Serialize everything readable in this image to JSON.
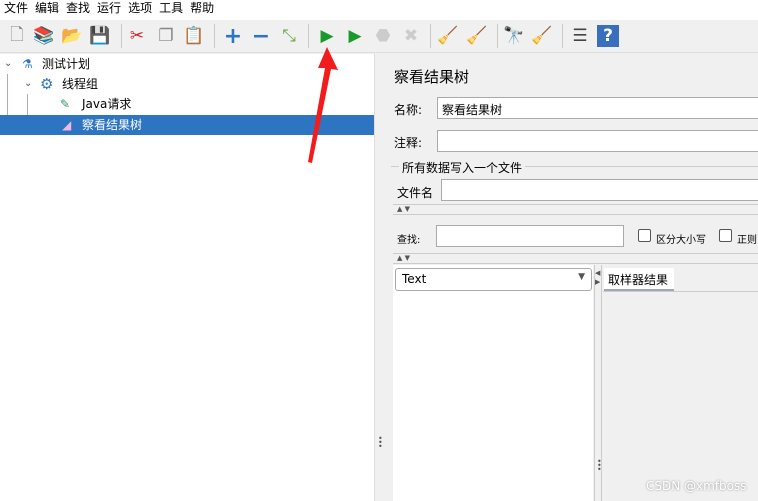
{
  "menu": [
    "文件",
    "编辑",
    "查找",
    "运行",
    "选项",
    "工具",
    "帮助"
  ],
  "toolbar": [
    {
      "icon": "new-icon",
      "glyph": "🗋",
      "color": "#888"
    },
    {
      "icon": "templates-icon",
      "glyph": "📚",
      "color": "#2a8"
    },
    {
      "icon": "open-icon",
      "glyph": "📂",
      "color": "#d9a030"
    },
    {
      "icon": "save-icon",
      "glyph": "💾",
      "color": "#444"
    },
    {
      "icon": "cut-icon",
      "glyph": "✂",
      "color": "#c22"
    },
    {
      "icon": "copy-icon",
      "glyph": "❐",
      "color": "#888"
    },
    {
      "icon": "paste-icon",
      "glyph": "📋",
      "color": "#a07030"
    },
    {
      "icon": "expand-icon",
      "glyph": "+",
      "color": "#2d74c1"
    },
    {
      "icon": "collapse-icon",
      "glyph": "−",
      "color": "#2d74c1"
    },
    {
      "icon": "toggle-icon",
      "glyph": "⤡",
      "color": "#6a4"
    },
    {
      "icon": "start-icon",
      "glyph": "▶",
      "color": "#1a9a2a"
    },
    {
      "icon": "start-no-pause-icon",
      "glyph": "▶",
      "color": "#1a9a2a"
    },
    {
      "icon": "stop-icon",
      "glyph": "⬣",
      "color": "#ccc"
    },
    {
      "icon": "shutdown-icon",
      "glyph": "✖",
      "color": "#ccc"
    },
    {
      "icon": "clear-icon",
      "glyph": "🧹",
      "color": "#a07030"
    },
    {
      "icon": "clear-all-icon",
      "glyph": "🧹",
      "color": "#a07030"
    },
    {
      "icon": "search-icon",
      "glyph": "🔭",
      "color": "#333"
    },
    {
      "icon": "reset-search-icon",
      "glyph": "🧹",
      "color": "#d9a030"
    },
    {
      "icon": "function-helper-icon",
      "glyph": "☰",
      "color": "#444"
    },
    {
      "icon": "help-icon",
      "glyph": "?",
      "color": "#fff"
    }
  ],
  "tree": [
    {
      "label": "测试计划",
      "icon": "test-plan-icon",
      "glyph": "⚗"
    },
    {
      "label": "线程组",
      "icon": "thread-group-icon",
      "glyph": "⚙"
    },
    {
      "label": "Java请求",
      "icon": "sampler-icon",
      "glyph": "✎"
    },
    {
      "label": "察看结果树",
      "icon": "listener-icon",
      "glyph": "◢",
      "selected": true
    }
  ],
  "panel": {
    "title": "察看结果树",
    "name_label": "名称:",
    "name_value": "察看结果树",
    "comment_label": "注释:",
    "comment_value": "",
    "file_group": "所有数据写入一个文件",
    "filename_label": "文件名",
    "filename_value": "",
    "search_label": "查找:",
    "search_value": "",
    "case_label": "区分大小写",
    "regex_label": "正则",
    "renderer": "Text",
    "tab": "取样器结果"
  },
  "accent": "#2d74c1",
  "watermark": "CSDN @xmfboss"
}
